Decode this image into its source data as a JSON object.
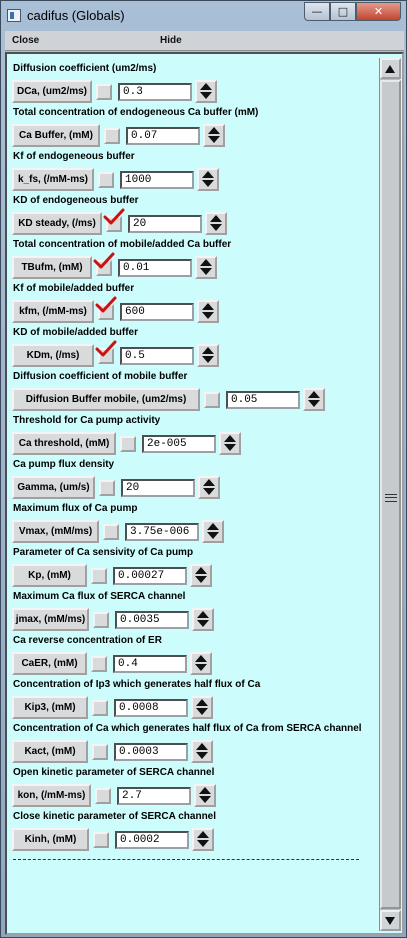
{
  "window": {
    "title": "cadifus (Globals)",
    "controls": {
      "minimize": "—",
      "maximize": "□",
      "close": "✕"
    }
  },
  "menu": {
    "close": "Close",
    "hide": "Hide"
  },
  "params": [
    {
      "desc": "Diffusion coefficient (um2/ms)",
      "button": "DCa, (um2/ms)",
      "value": "0.3",
      "changed": false
    },
    {
      "desc": "Total concentration of endogeneous Ca buffer (mM)",
      "button": "Ca Buffer, (mM)",
      "value": "0.07",
      "changed": false
    },
    {
      "desc": "Kf of endogeneous buffer",
      "button": "k_fs, (/mM-ms)",
      "value": "1000",
      "changed": false
    },
    {
      "desc": "KD of endogeneous buffer",
      "button": "KD steady, (/ms)",
      "value": "20",
      "changed": true
    },
    {
      "desc": "Total concentration of mobile/added Ca buffer",
      "button": "TBufm, (mM)",
      "value": "0.01",
      "changed": true
    },
    {
      "desc": "Kf of mobile/added buffer",
      "button": "kfm, (/mM-ms)",
      "value": "600",
      "changed": true
    },
    {
      "desc": "KD of mobile/added buffer",
      "button": "KDm, (/ms)",
      "value": "0.5",
      "changed": true
    },
    {
      "desc": "Diffusion coefficient of mobile buffer",
      "button": "Diffusion Buffer mobile, (um2/ms)",
      "value": "0.05",
      "changed": false
    },
    {
      "desc": "Threshold for Ca pump activity",
      "button": "Ca threshold, (mM)",
      "value": "2e-005",
      "changed": false
    },
    {
      "desc": "Ca pump flux density",
      "button": "Gamma, (um/s)",
      "value": "20",
      "changed": false
    },
    {
      "desc": "Maximum flux of Ca pump",
      "button": "Vmax, (mM/ms)",
      "value": "3.75e-006",
      "changed": false
    },
    {
      "desc": "Parameter of Ca sensivity of Ca pump",
      "button": "Kp, (mM)",
      "value": "0.00027",
      "changed": false
    },
    {
      "desc": "Maximum Ca flux of SERCA channel",
      "button": "jmax, (mM/ms)",
      "value": "0.0035",
      "changed": false
    },
    {
      "desc": "Ca reverse concentration of ER",
      "button": "CaER, (mM)",
      "value": "0.4",
      "changed": false
    },
    {
      "desc": "Concentration of Ip3 which generates half flux of Ca",
      "button": "Kip3, (mM)",
      "value": "0.0008",
      "changed": false
    },
    {
      "desc": "Concentration of Ca  which generates half flux of Ca from SERCA channel",
      "button": "Kact, (mM)",
      "value": "0.0003",
      "changed": false
    },
    {
      "desc": "Open kinetic parameter of  SERCA channel",
      "button": "kon, (/mM-ms)",
      "value": "2.7",
      "changed": false
    },
    {
      "desc": "Close kinetic parameter of  SERCA channel",
      "button": "Kinh, (mM)",
      "value": "0.0002",
      "changed": false
    }
  ],
  "colors": {
    "panel": "#ccfcfc",
    "checkmark": "#cc1111"
  }
}
